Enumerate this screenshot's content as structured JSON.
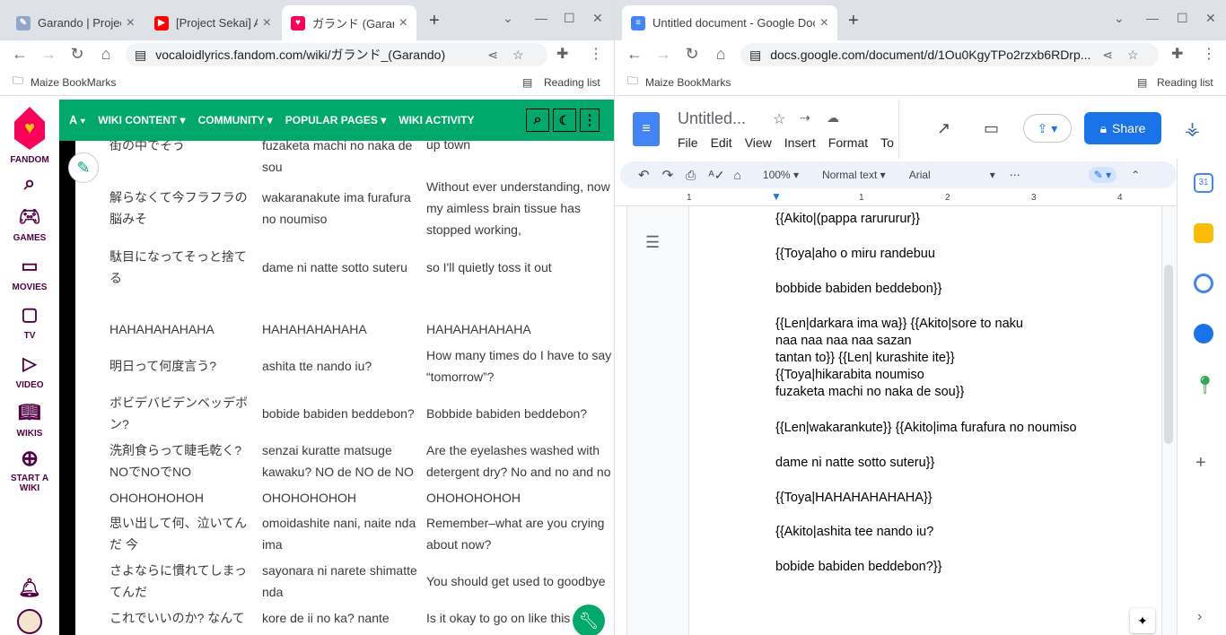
{
  "left_window": {
    "tabs": [
      {
        "title": "Garando | Project",
        "favicon": "project-icon"
      },
      {
        "title": "[Project Sekai] A",
        "favicon": "youtube-icon"
      },
      {
        "title": "ガランド (Garan",
        "favicon": "fandom-icon"
      }
    ],
    "url": "vocaloidlyrics.fandom.com/wiki/ガランド_(Garando)",
    "bookmarks": {
      "folder": "Maize BookMarks",
      "reading_list": "Reading list"
    },
    "rail": [
      {
        "label": "FANDOM",
        "icon": "fandom-heart-icon"
      },
      {
        "label": "",
        "icon": "search-icon"
      },
      {
        "label": "GAMES",
        "icon": "gamepad-icon"
      },
      {
        "label": "MOVIES",
        "icon": "movie-icon"
      },
      {
        "label": "TV",
        "icon": "tv-icon"
      },
      {
        "label": "VIDEO",
        "icon": "video-icon"
      },
      {
        "label": "WIKIS",
        "icon": "book-icon"
      },
      {
        "label": "START A WIKI",
        "icon": "plus-circle-icon"
      }
    ],
    "nav": [
      "WIKI CONTENT",
      "COMMUNITY",
      "POPULAR PAGES",
      "WIKI ACTIVITY"
    ],
    "rows": [
      {
        "c1": "街の中でそう",
        "c2": "fuzaketa machi no naka de sou",
        "c3": "up town"
      },
      {
        "c1": "解らなくて今フラフラの脳みそ",
        "c2": "wakaranakute ima furafura no noumiso",
        "c3": "Without ever understanding, now my aimless brain tissue has stopped working,"
      },
      {
        "c1": "駄目になってそっと捨てる",
        "c2": "dame ni natte sotto suteru",
        "c3": "so I'll quietly toss it out"
      },
      {
        "c1": "HAHAHAHAHAHA",
        "c2": "HAHAHAHAHAHA",
        "c3": "HAHAHAHAHAHA"
      },
      {
        "c1": "明日って何度言う?",
        "c2": "ashita tte nando iu?",
        "c3": "How many times do I have to say “tomorrow”?"
      },
      {
        "c1": "ボビデバビデンベッデボン?",
        "c2": "bobide babiden beddebon?",
        "c3": "Bobbide babiden beddebon?"
      },
      {
        "c1": "洗剤食らって睫毛乾く? NOでNOでNO",
        "c2": "senzai kuratte matsuge kawaku? NO de NO de NO",
        "c3": "Are the eyelashes washed with detergent dry? No and no and no"
      },
      {
        "c1": "OHOHOHOHOH",
        "c2": "OHOHOHOHOH",
        "c3": "OHOHOHOHOH"
      },
      {
        "c1": "思い出して何、泣いてんだ 今",
        "c2": "omoidashite nani, naite nda ima",
        "c3": "Remember–what are you crying about now?"
      },
      {
        "c1": "さよならに慣れてしまってんだ",
        "c2": "sayonara ni narete shimatte nda",
        "c3": "You should get used to goodbye"
      },
      {
        "c1": "これでいいのか? なんて",
        "c2": "kore de ii no ka? nante",
        "c3": "Is it okay to go on like this"
      }
    ]
  },
  "right_window": {
    "tab_title": "Untitled document - Google Docs",
    "url": "docs.google.com/document/d/1Ou0KgyTPo2rzxb6RDrp...",
    "bookmarks": {
      "folder": "Maize BookMarks",
      "reading_list": "Reading list"
    },
    "doc_title": "Untitled...",
    "menu": [
      "File",
      "Edit",
      "View",
      "Insert",
      "Format",
      "To"
    ],
    "share": "Share",
    "zoom": "100%",
    "style": "Normal text",
    "font": "Arial",
    "lines": [
      "{{Akito|(pappa rarururur}}",
      "{{Toya|aho o miru randebuu",
      "bobbide babiden beddebon}}",
      "{{Len|darkara ima wa}} {{Akito|sore to naku",
      "naa naa naa naa sazan",
      "tantan to}} {{Len| kurashite ite}}",
      "{{Toya|hikarabita noumiso",
      "fuzaketa machi no naka de sou}}",
      "{{Len|wakarankute}} {{Akito|ima furafura no noumiso",
      "dame ni natte sotto suteru}}",
      "{{Toya|HAHAHAHAHAHA}}",
      "{{Akito|ashita tee nando iu?",
      "bobide babiden beddebon?}}"
    ]
  }
}
